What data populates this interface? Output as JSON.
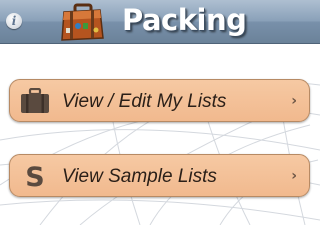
{
  "header": {
    "title": "Packing",
    "info_icon": "info-icon",
    "info_glyph": "i",
    "logo_icon": "suitcase-logo-icon"
  },
  "menu": [
    {
      "label": "View / Edit My Lists",
      "icon": "suitcase-icon",
      "chevron": "›"
    },
    {
      "label": "View Sample Lists",
      "icon": "sample-s-icon",
      "icon_glyph": "S",
      "chevron": "›"
    }
  ],
  "colors": {
    "titlebar": "#8aa1b9",
    "button_fill": "#f3c19a",
    "button_border": "#b78a64",
    "icon_brown": "#5a4a3f"
  }
}
